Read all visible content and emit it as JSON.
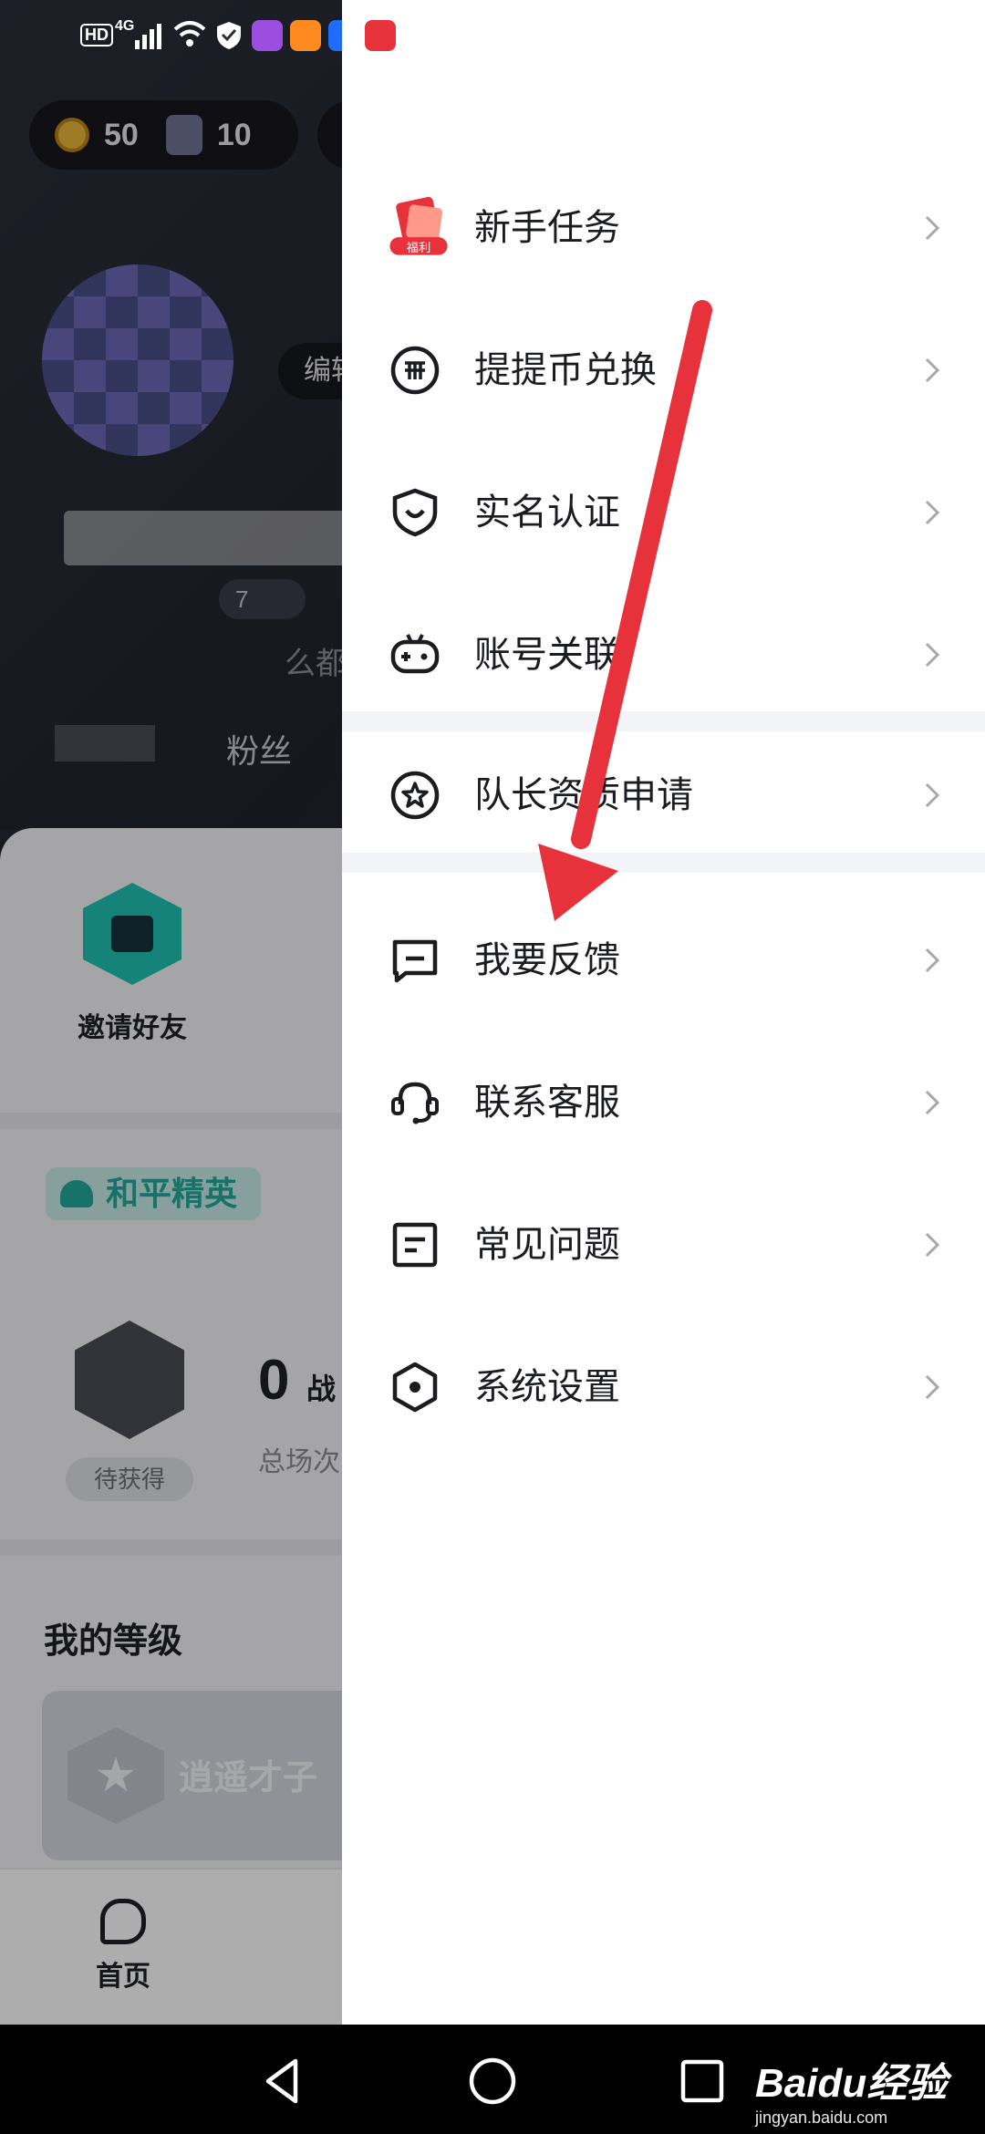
{
  "status_bar": {
    "hd": "HD",
    "network": "4G"
  },
  "background": {
    "stats": {
      "coins": "50",
      "cards": "10"
    },
    "edit_label": "编辑",
    "id_suffix": "7",
    "bio_fragment": "么都",
    "fans_label": "粉丝",
    "invite_label": "邀请好友",
    "game_tag": "和平精英",
    "stats_zero": "0",
    "stats_unit": "战",
    "total_label": "总场次",
    "badge_label": "待获得",
    "level_title": "我的等级",
    "level_name": "逍遥才子",
    "tab_home": "首页"
  },
  "drawer": {
    "group1": [
      {
        "label": "新手任务",
        "icon": "gift-icon",
        "tag": "福利"
      },
      {
        "label": "提提币兑换",
        "icon": "coin-icon"
      },
      {
        "label": "实名认证",
        "icon": "shield-icon"
      },
      {
        "label": "账号关联",
        "icon": "gamepad-icon"
      }
    ],
    "group2": [
      {
        "label": "队长资质申请",
        "icon": "star-badge-icon"
      }
    ],
    "group3": [
      {
        "label": "我要反馈",
        "icon": "feedback-icon"
      },
      {
        "label": "联系客服",
        "icon": "headset-icon"
      },
      {
        "label": "常见问题",
        "icon": "faq-icon"
      },
      {
        "label": "系统设置",
        "icon": "settings-icon"
      }
    ]
  },
  "watermark": {
    "brand": "Baidu经验",
    "url": "jingyan.baidu.com"
  },
  "colors": {
    "accent_red": "#e8323b",
    "teal": "#1fc2b2",
    "separator": "#f3f4f7"
  }
}
